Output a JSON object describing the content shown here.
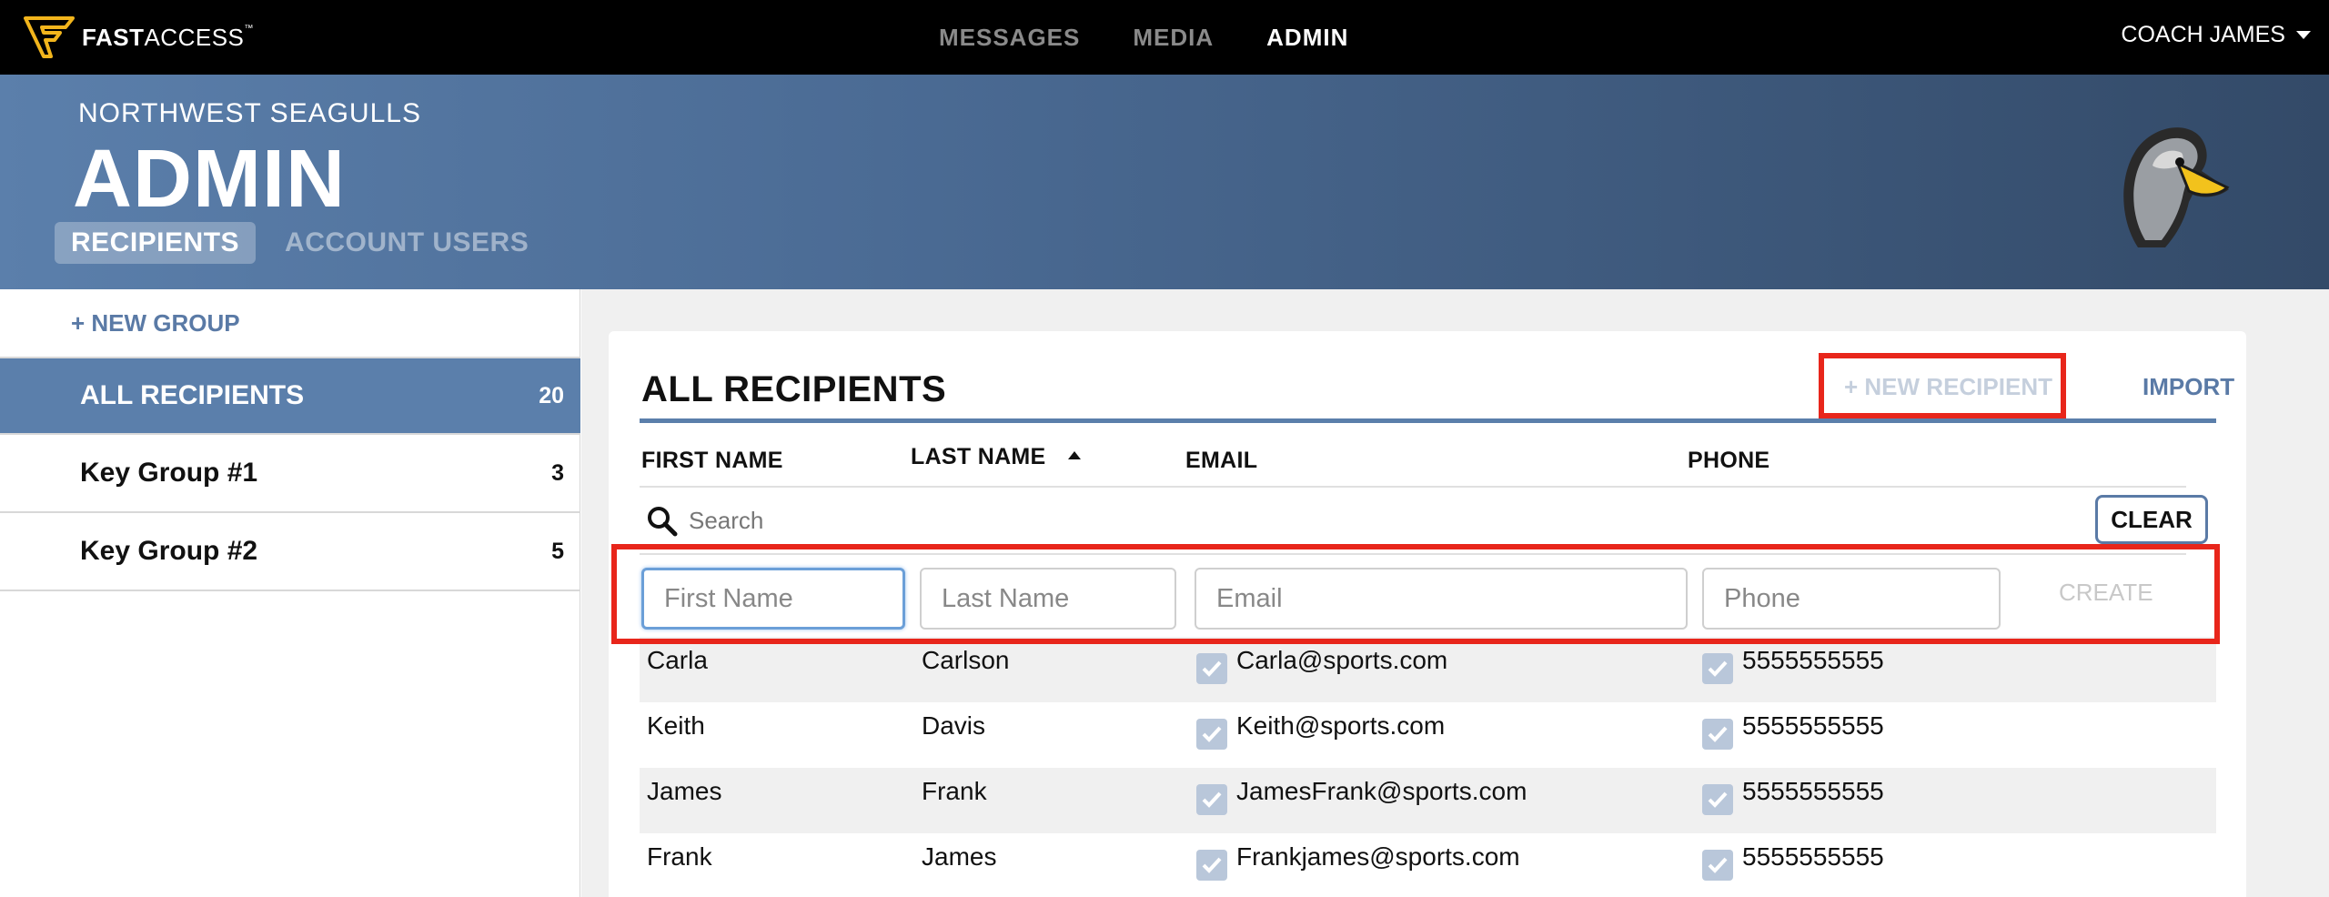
{
  "brand": {
    "strong": "FAST",
    "light": "ACCESS",
    "tm": "™"
  },
  "topnav": {
    "items": [
      {
        "label": "MESSAGES"
      },
      {
        "label": "MEDIA"
      },
      {
        "label": "ADMIN"
      }
    ],
    "active": "ADMIN",
    "user": "COACH JAMES"
  },
  "banner": {
    "org": "NORTHWEST SEAGULLS",
    "title": "ADMIN",
    "tabs": [
      {
        "label": "RECIPIENTS"
      },
      {
        "label": "ACCOUNT USERS"
      }
    ]
  },
  "sidebar": {
    "new_group": "+ NEW GROUP",
    "groups": [
      {
        "label": "ALL RECIPIENTS",
        "count": "20"
      },
      {
        "label": "Key Group #1",
        "count": "3"
      },
      {
        "label": "Key Group #2",
        "count": "5"
      }
    ]
  },
  "card": {
    "title": "ALL RECIPIENTS",
    "new_recipient": "+ NEW RECIPIENT",
    "import": "IMPORT",
    "columns": [
      "FIRST NAME",
      "LAST NAME",
      "EMAIL",
      "PHONE"
    ],
    "search_placeholder": "Search",
    "clear": "CLEAR",
    "form": {
      "first_placeholder": "First Name",
      "last_placeholder": "Last Name",
      "email_placeholder": "Email",
      "phone_placeholder": "Phone",
      "create": "CREATE"
    },
    "rows": [
      {
        "first": "Carla",
        "last": "Carlson",
        "email": "Carla@sports.com",
        "phone": "5555555555"
      },
      {
        "first": "Keith",
        "last": "Davis",
        "email": "Keith@sports.com",
        "phone": "5555555555"
      },
      {
        "first": "James",
        "last": "Frank",
        "email": "JamesFrank@sports.com",
        "phone": "5555555555"
      },
      {
        "first": "Frank",
        "last": "James",
        "email": "Frankjames@sports.com",
        "phone": "5555555555"
      }
    ]
  },
  "colors": {
    "accent": "#5b7fab",
    "highlight": "#e8261b",
    "logo_gold": "#f2b51c"
  }
}
